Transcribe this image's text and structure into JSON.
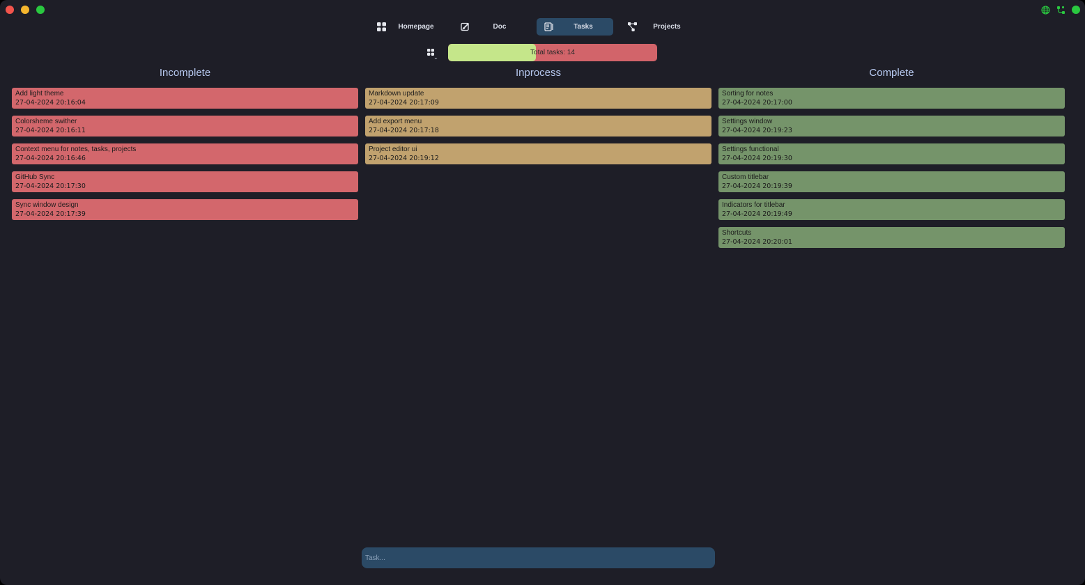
{
  "window": {
    "controls": [
      "close",
      "minimize",
      "maximize"
    ],
    "indicators": [
      {
        "icon": "globe-icon",
        "color": "#2ac840"
      },
      {
        "icon": "git-branch-icon",
        "color": "#2ac840"
      },
      {
        "icon": "status-dot-icon",
        "color": "#2ac840"
      }
    ]
  },
  "nav": {
    "items": [
      {
        "label": "Homepage",
        "icon": "grid-icon",
        "active": false
      },
      {
        "label": "Doc",
        "icon": "edit-icon",
        "active": false
      },
      {
        "label": "Tasks",
        "icon": "tasks-icon",
        "active": true
      },
      {
        "label": "Projects",
        "icon": "project-icon",
        "active": false
      }
    ]
  },
  "toolbar": {
    "filter_icon": "grid-dropdown-icon",
    "progress": {
      "label": "Total tasks: 14",
      "completed_fraction": 0.42,
      "fill_color": "#c5e68a",
      "track_color": "#d2646a"
    }
  },
  "columns": [
    {
      "title": "Incomplete",
      "color": "#d3676c",
      "tasks": [
        {
          "title": "Add light theme",
          "date": "27-04-2024 20:16:04"
        },
        {
          "title": "Colorsheme swither",
          "date": "27-04-2024 20:16:11"
        },
        {
          "title": "Context menu for notes, tasks, projects",
          "date": "27-04-2024 20:16:46"
        },
        {
          "title": "GitHub Sync",
          "date": "27-04-2024 20:17:30"
        },
        {
          "title": "Sync window design",
          "date": "27-04-2024 20:17:39"
        }
      ]
    },
    {
      "title": "Inprocess",
      "color": "#c1a26e",
      "tasks": [
        {
          "title": "Markdown update",
          "date": "27-04-2024 20:17:09"
        },
        {
          "title": "Add export menu",
          "date": "27-04-2024 20:17:18"
        },
        {
          "title": "Project editor ui",
          "date": "27-04-2024 20:19:12"
        }
      ]
    },
    {
      "title": "Complete",
      "color": "#75946a",
      "tasks": [
        {
          "title": "Sorting for notes",
          "date": "27-04-2024 20:17:00"
        },
        {
          "title": "Settings window",
          "date": "27-04-2024 20:19:23"
        },
        {
          "title": "Settings functional",
          "date": "27-04-2024 20:19:30"
        },
        {
          "title": "Custom titlebar",
          "date": "27-04-2024 20:19:39"
        },
        {
          "title": "Indicators for titlebar",
          "date": "27-04-2024 20:19:49"
        },
        {
          "title": "Shortcuts",
          "date": "27-04-2024 20:20:01"
        }
      ]
    }
  ],
  "input": {
    "placeholder": "Task...",
    "value": ""
  }
}
